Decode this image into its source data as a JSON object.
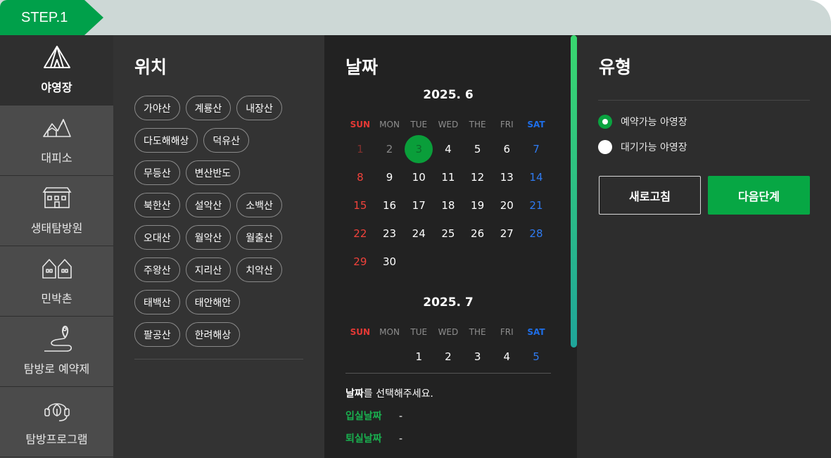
{
  "step": {
    "label": "STEP.1"
  },
  "nav": {
    "items": [
      {
        "label": "야영장",
        "icon": "tent-icon",
        "active": true
      },
      {
        "label": "대피소",
        "icon": "mountain-shelter-icon",
        "active": false
      },
      {
        "label": "생태탐방원",
        "icon": "building-icon",
        "active": false
      },
      {
        "label": "민박촌",
        "icon": "houses-icon",
        "active": false
      },
      {
        "label": "탐방로 예약제",
        "icon": "trail-pin-icon",
        "active": false
      },
      {
        "label": "탐방프로그램",
        "icon": "leaf-headset-icon",
        "active": false
      }
    ]
  },
  "location": {
    "title": "위치",
    "rows": [
      [
        "가야산",
        "계룡산",
        "내장산"
      ],
      [
        "다도해해상",
        "덕유산"
      ],
      [
        "무등산",
        "변산반도"
      ],
      [
        "북한산",
        "설악산",
        "소백산"
      ],
      [
        "오대산",
        "월악산",
        "월출산"
      ],
      [
        "주왕산",
        "지리산",
        "치악산"
      ],
      [
        "태백산",
        "태안해안"
      ],
      [
        "팔공산",
        "한려해상"
      ]
    ]
  },
  "date": {
    "title": "날짜",
    "dow": [
      "SUN",
      "MON",
      "TUE",
      "WED",
      "THE",
      "FRI",
      "SAT"
    ],
    "months": [
      {
        "title": "2025. 6",
        "weeks": [
          [
            "1",
            "2",
            "3",
            "4",
            "5",
            "6",
            "7"
          ],
          [
            "8",
            "9",
            "10",
            "11",
            "12",
            "13",
            "14"
          ],
          [
            "15",
            "16",
            "17",
            "18",
            "19",
            "20",
            "21"
          ],
          [
            "22",
            "23",
            "24",
            "25",
            "26",
            "27",
            "28"
          ],
          [
            "29",
            "30",
            "",
            "",
            "",
            "",
            ""
          ]
        ],
        "past_days": [
          "1",
          "2"
        ],
        "selected_day": "3"
      },
      {
        "title": "2025. 7",
        "weeks": [
          [
            "",
            "",
            "1",
            "2",
            "3",
            "4",
            "5"
          ]
        ],
        "past_days": [],
        "selected_day": ""
      }
    ],
    "prompt_bold": "날짜",
    "prompt_rest": "를 선택해주세요.",
    "checkin_label": "입실날짜",
    "checkin_value": "-",
    "checkout_label": "퇴실날짜",
    "checkout_value": "-"
  },
  "type": {
    "title": "유형",
    "options": [
      {
        "label": "예약가능 야영장",
        "checked": true
      },
      {
        "label": "대기가능 야영장",
        "checked": false
      }
    ],
    "refresh_label": "새로고침",
    "next_label": "다음단계"
  },
  "colors": {
    "accent_green": "#00a04a",
    "sunday_red": "#f0423b",
    "saturday_blue": "#2f7bf0"
  }
}
